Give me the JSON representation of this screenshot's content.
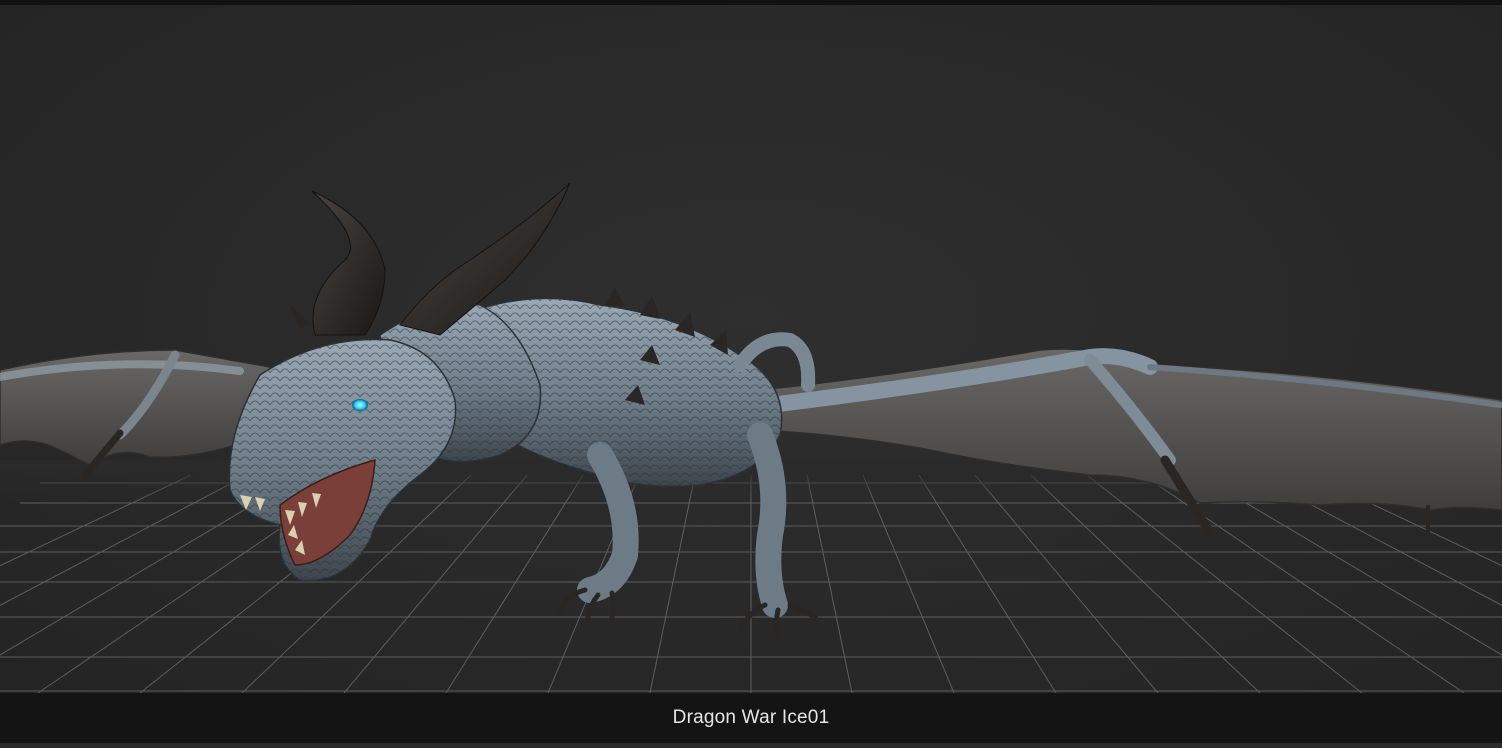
{
  "viewer": {
    "model_title": "Dragon War Ice01",
    "background_color": "#2a2a2a",
    "grid_color": "#8a8a8a",
    "caption_bar_color": "#141414",
    "model_colors": {
      "scales": "#6f7f8c",
      "wing_membrane": "#555453",
      "horns": "#2a2624",
      "eye": "#32d0ff",
      "mouth": "#7a3f38"
    }
  }
}
